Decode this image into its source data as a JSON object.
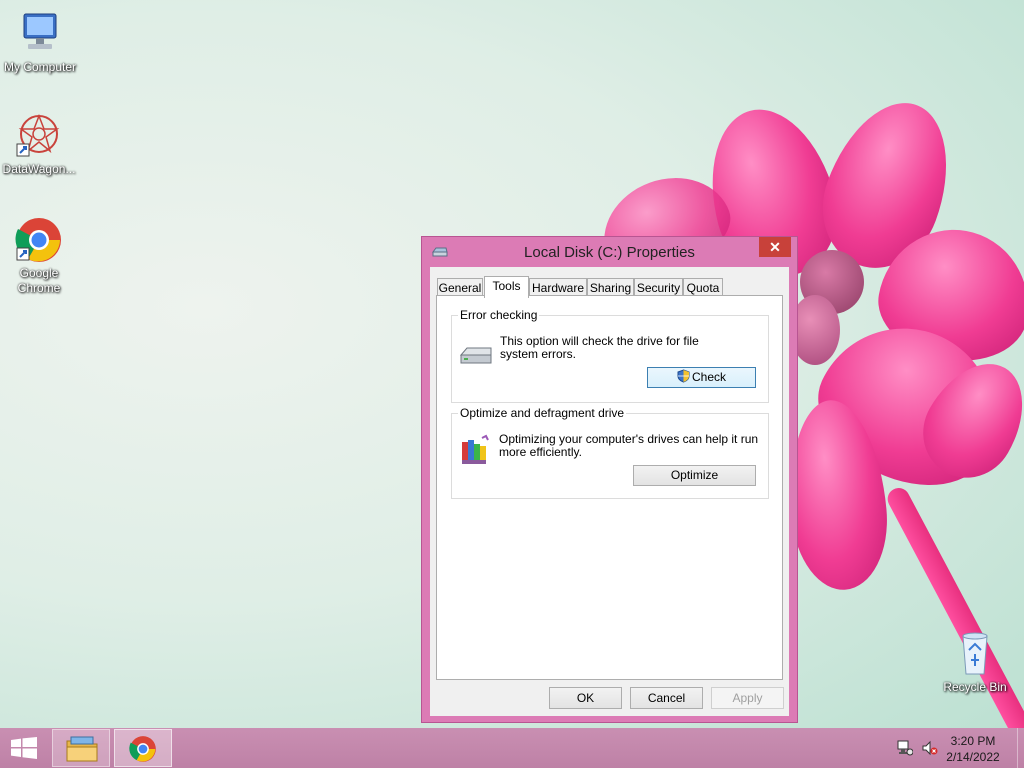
{
  "desktop": {
    "icons": [
      {
        "label": "My Computer",
        "icon": "computer-icon"
      },
      {
        "label": "DataWagon...",
        "icon": "datawagon-icon"
      },
      {
        "label": "Google Chrome",
        "icon": "chrome-icon"
      },
      {
        "label": "Recycle Bin",
        "icon": "recycle-bin-icon"
      }
    ]
  },
  "window": {
    "title": "Local Disk (C:) Properties",
    "close_glyph": "✕",
    "tabs": [
      {
        "label": "General"
      },
      {
        "label": "Tools"
      },
      {
        "label": "Hardware"
      },
      {
        "label": "Sharing"
      },
      {
        "label": "Security"
      },
      {
        "label": "Quota"
      }
    ],
    "active_tab": "Tools",
    "error_checking": {
      "legend": "Error checking",
      "line1": "This option will check the drive for file",
      "line2": "system errors.",
      "button": "Check"
    },
    "optimize": {
      "legend": "Optimize and defragment drive",
      "line1": "Optimizing your computer's drives can help it run",
      "line2": "more efficiently.",
      "button": "Optimize"
    },
    "footer": {
      "ok": "OK",
      "cancel": "Cancel",
      "apply": "Apply"
    }
  },
  "taskbar": {
    "start_icon": "windows-logo-icon",
    "pinned": [
      {
        "name": "file-explorer-icon"
      },
      {
        "name": "chrome-icon"
      }
    ],
    "tray": {
      "network_icon": "network-icon",
      "volume_icon": "volume-muted-icon"
    },
    "clock": {
      "time": "3:20 PM",
      "date": "2/14/2022"
    }
  },
  "colors": {
    "window_frame": "#dc7bb5",
    "taskbar": "#c48aad",
    "close_button": "#c8413a"
  }
}
